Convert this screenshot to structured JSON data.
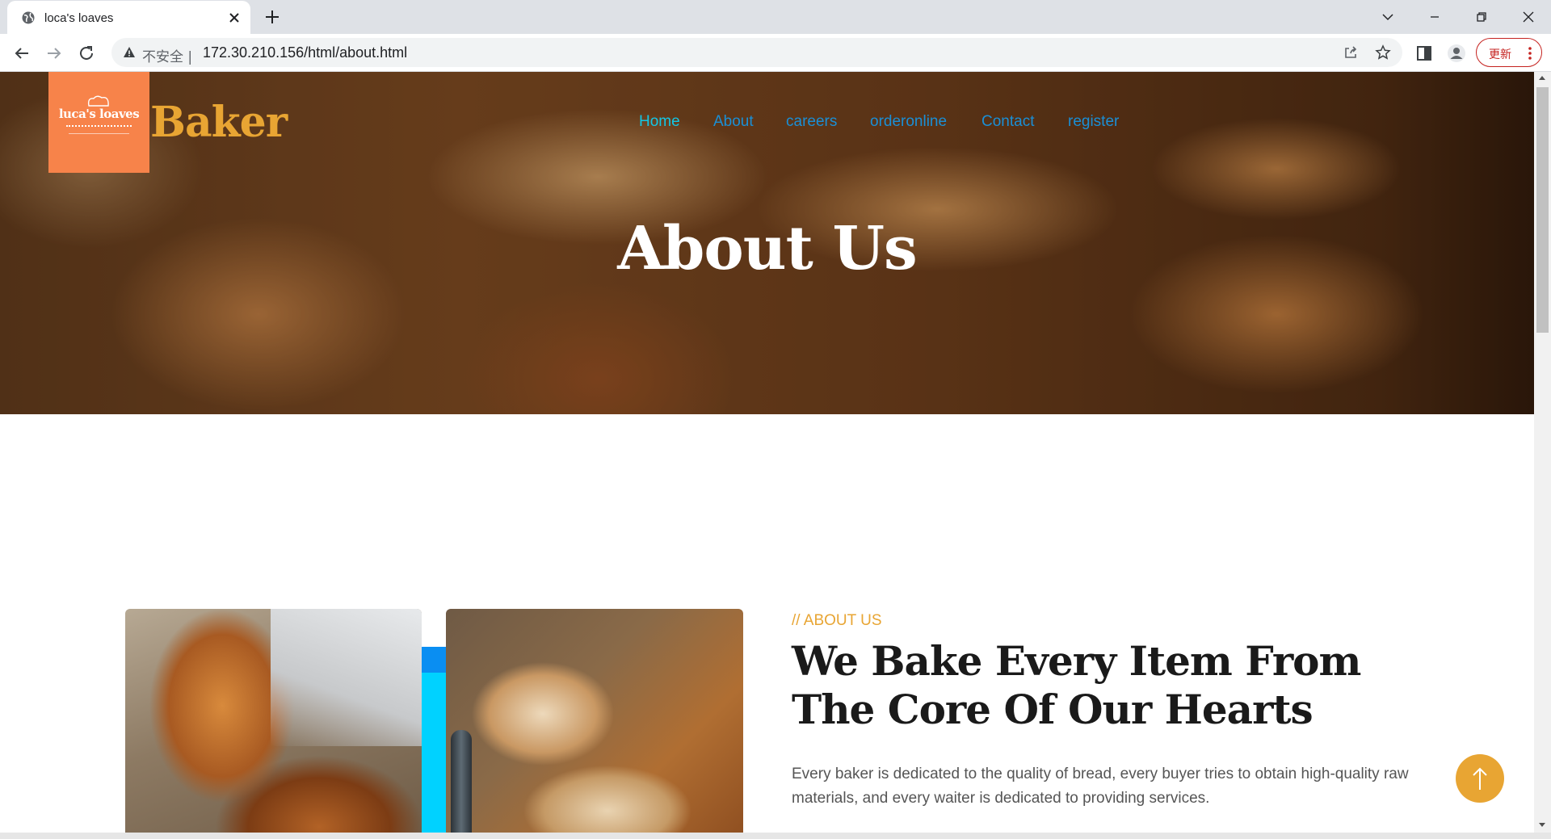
{
  "browser": {
    "tab_title": "loca's loaves",
    "security_label": "不安全 |",
    "url": "172.30.210.156/html/about.html",
    "update_label": "更新"
  },
  "site": {
    "logo_text": "luca's loaves",
    "brand": "Baker",
    "nav": [
      {
        "label": "Home",
        "active": true
      },
      {
        "label": "About"
      },
      {
        "label": "careers"
      },
      {
        "label": "orderonline"
      },
      {
        "label": "Contact"
      },
      {
        "label": "register"
      }
    ],
    "hero_title": "About Us"
  },
  "about": {
    "eyebrow": "// ABOUT US",
    "heading": "We Bake Every Item From The Core Of Our Hearts",
    "paragraph": "Every baker is dedicated to the quality of bread, every buyer tries to obtain high-quality raw materials, and every waiter is dedicated to providing services."
  },
  "colors": {
    "accent": "#e8a533",
    "nav_link": "#1a8fd6",
    "nav_active": "#12c7e6",
    "logo_bg": "#f7834a",
    "cyan_bar": "#00d2ff"
  },
  "icons": [
    "globe-icon",
    "close-icon",
    "plus-icon",
    "chevron-down-icon",
    "minimize-icon",
    "restore-icon",
    "window-close-icon",
    "back-arrow-icon",
    "forward-arrow-icon",
    "reload-icon",
    "warning-icon",
    "share-icon",
    "star-icon",
    "sidepanel-icon",
    "profile-icon",
    "more-vert-icon",
    "arrow-up-icon"
  ]
}
